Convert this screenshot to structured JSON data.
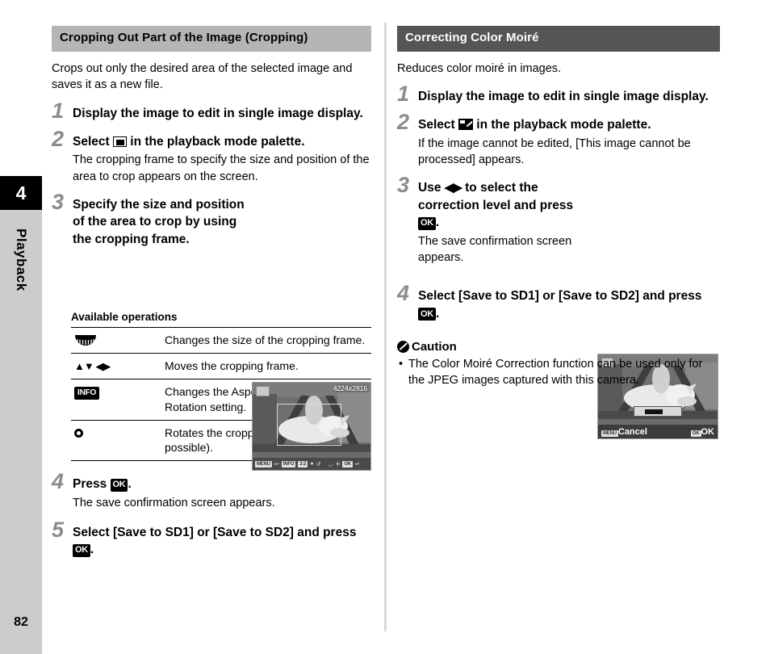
{
  "page": {
    "number": "82",
    "chapter_number": "4",
    "chapter_label": "Playback"
  },
  "left_column": {
    "header": "Cropping Out Part of the Image (Cropping)",
    "intro": "Crops out only the desired area of the selected image and saves it as a new file.",
    "steps": [
      {
        "num": "1",
        "title": "Display the image to edit in single image display.",
        "note": ""
      },
      {
        "num": "2",
        "title_before": "Select",
        "icon": "crop-icon",
        "title_after": "in the playback mode palette.",
        "note": "The cropping frame to specify the size and position of the area to crop appears on the screen."
      },
      {
        "num": "3",
        "title": "Specify the size and position of the area to crop by using the cropping frame.",
        "note": ""
      },
      {
        "num": "4",
        "title_before": "Press",
        "icon": "ok-badge",
        "icon_label": "OK",
        "title_after": ".",
        "note": "The save confirmation screen appears."
      },
      {
        "num": "5",
        "title_before": "Select [Save to SD1] or [Save to SD2] and press",
        "icon": "ok-badge",
        "icon_label": "OK",
        "title_after": ".",
        "note": ""
      }
    ],
    "operations": {
      "title": "Available operations",
      "rows": [
        {
          "key_icon": "e-dial-icon",
          "key_label": "",
          "desc": "Changes the size of the cropping frame."
        },
        {
          "key_icon": "four-way-arrows-icon",
          "key_label": "▲▼ ◀▶",
          "desc": "Moves the cropping frame."
        },
        {
          "key_icon": "info-badge-icon",
          "key_label": "INFO",
          "desc": "Changes the Aspect Ratio or Image Rotation setting."
        },
        {
          "key_icon": "green-button-icon",
          "key_label": "",
          "desc": "Rotates the cropping frame (only when possible)."
        }
      ]
    },
    "lcd": {
      "resolution": "4224x2816",
      "bar_items": [
        "MENU",
        "↩",
        "INFO",
        "3:2",
        "●",
        "↺",
        "◡",
        "✛",
        "OK",
        "↵"
      ]
    }
  },
  "right_column": {
    "header": "Correcting Color Moiré",
    "intro": "Reduces color moiré in images.",
    "steps": [
      {
        "num": "1",
        "title": "Display the image to edit in single image display.",
        "note": ""
      },
      {
        "num": "2",
        "title_before": "Select",
        "icon": "moire-icon",
        "title_after": "in the playback mode palette.",
        "note": "If the image cannot be edited, [This image cannot be processed] appears."
      },
      {
        "num": "3",
        "title_before": "Use",
        "icon": "left-right-arrows",
        "icon_label": "◀▶",
        "title_mid": "to select the correction level and press",
        "icon2": "ok-badge",
        "icon2_label": "OK",
        "title_after": ".",
        "note": "The save confirmation screen appears."
      },
      {
        "num": "4",
        "title_before": "Select [Save to SD1] or [Save to SD2] and press",
        "icon": "ok-badge",
        "icon_label": "OK",
        "title_after": ".",
        "note": ""
      }
    ],
    "caution": {
      "title": "Caution",
      "bullet": "•",
      "items": [
        "The Color Moiré Correction function can be used only for the JPEG images captured with this camera."
      ]
    },
    "lcd": {
      "cancel_badge": "MENU",
      "cancel_label": "Cancel",
      "ok_badge": "OK",
      "ok_label": "OK"
    }
  },
  "colors": {
    "header_light_bg": "#b5b5b5",
    "header_dark_bg": "#555555",
    "side_tab_bg": "#cccccc",
    "side_tab_number_bg": "#000000",
    "step_number": "#8c8c8c",
    "divider": "#d9d9d9"
  }
}
